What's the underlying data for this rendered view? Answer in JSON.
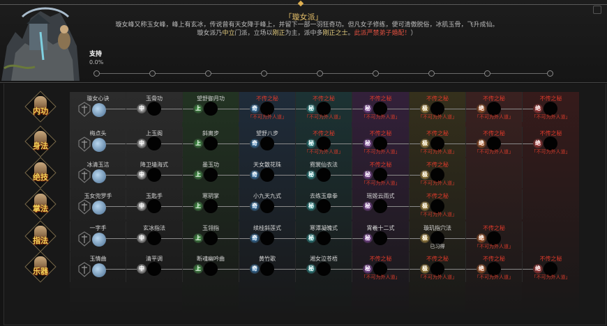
{
  "sect": {
    "title": "「璇女派」",
    "desc_line1": "璇女峰又称玉女峰，峰上有玄冰，传说曾有天女降于峰上，并留下一部一羽狂奇功。但凡女子修练，便可清傲脱俗，冰肌玉骨，飞升成仙。",
    "desc_line2_a": "璇女派乃",
    "desc_line2_b": "中立",
    "desc_line2_c": "门派，立场以",
    "desc_line2_d": "刚正",
    "desc_line2_e": "为主，派中多",
    "desc_line2_f": "刚正之士",
    "desc_line2_g": "。",
    "desc_line2_h": "此派严禁弟子婚配！",
    "desc_line2_i": "）"
  },
  "support": {
    "label": "支持",
    "percent": "0.0%",
    "value": 0
  },
  "tier_colors": [
    "#2c2c2c",
    "#2c2c2c",
    "#223322",
    "#1f2c3a",
    "#1c3334",
    "#33203a",
    "#35301c",
    "#3a2120",
    "#361b1b"
  ],
  "badges": [
    {
      "char": "中",
      "color": "#e6e6e6"
    },
    {
      "char": "中",
      "color": "#e6e6e6"
    },
    {
      "char": "上",
      "color": "#4caf50"
    },
    {
      "char": "奇",
      "color": "#3a8fd6"
    },
    {
      "char": "秘",
      "color": "#2ab0b0"
    },
    {
      "char": "秘",
      "color": "#a34fc8"
    },
    {
      "char": "极",
      "color": "#e2b64a"
    },
    {
      "char": "绝",
      "color": "#e06a2a"
    },
    {
      "char": "绝",
      "color": "#d93a3a"
    }
  ],
  "rows": [
    {
      "category": "内功",
      "cells": [
        {
          "name": "璇女心诀",
          "state": "first"
        },
        {
          "name": "玉骨功",
          "state": "open"
        },
        {
          "name": "望舒御月功",
          "state": "open"
        },
        {
          "name": "不传之秘",
          "state": "locked",
          "sub": "「不可为外人道」"
        },
        {
          "name": "不传之秘",
          "state": "locked",
          "sub": "「不可为外人道」"
        },
        {
          "name": "不传之秘",
          "state": "locked",
          "sub": "「不可为外人道」"
        },
        {
          "name": "不传之秘",
          "state": "locked",
          "sub": "「不可为外人道」"
        },
        {
          "name": "不传之秘",
          "state": "locked",
          "sub": "「不可为外人道」"
        },
        {
          "name": "不传之秘",
          "state": "locked",
          "sub": "「不可为外人道」"
        }
      ]
    },
    {
      "category": "身法",
      "cells": [
        {
          "name": "梅点头",
          "state": "first"
        },
        {
          "name": "上玉阁",
          "state": "open"
        },
        {
          "name": "斜离步",
          "state": "open"
        },
        {
          "name": "望舒八步",
          "state": "open"
        },
        {
          "name": "不传之秘",
          "state": "locked",
          "sub": "「不可为外人道」"
        },
        {
          "name": "不传之秘",
          "state": "locked",
          "sub": "「不可为外人道」"
        },
        {
          "name": "不传之秘",
          "state": "locked",
          "sub": "「不可为外人道」"
        },
        {
          "name": "不传之秘",
          "state": "locked",
          "sub": "「不可为外人道」"
        },
        {
          "name": "不传之秘",
          "state": "locked",
          "sub": "「不可为外人道」"
        }
      ]
    },
    {
      "category": "绝技",
      "cells": [
        {
          "name": "冰清玉洁",
          "state": "first"
        },
        {
          "name": "降卫墙海式",
          "state": "open"
        },
        {
          "name": "墨玉功",
          "state": "open"
        },
        {
          "name": "天女散花珠",
          "state": "open"
        },
        {
          "name": "霓裳仙衣法",
          "state": "open"
        },
        {
          "name": "不传之秘",
          "state": "locked",
          "sub": "「不可为外人道」"
        },
        {
          "name": "不传之秘",
          "state": "locked",
          "sub": "「不可为外人道」"
        },
        {
          "name": "",
          "state": "empty"
        },
        {
          "name": "",
          "state": "empty"
        }
      ]
    },
    {
      "category": "掌法",
      "cells": [
        {
          "name": "玉女兜罗手",
          "state": "first"
        },
        {
          "name": "玉匙手",
          "state": "open"
        },
        {
          "name": "寒玥掌",
          "state": "open"
        },
        {
          "name": "小九天九式",
          "state": "open"
        },
        {
          "name": "去练玉章拳",
          "state": "open"
        },
        {
          "name": "瑶姬云雨式",
          "state": "open"
        },
        {
          "name": "不传之秘",
          "state": "locked",
          "sub": "「不可为外人道」"
        },
        {
          "name": "",
          "state": "empty"
        },
        {
          "name": "",
          "state": "empty"
        }
      ]
    },
    {
      "category": "指法",
      "cells": [
        {
          "name": "一字手",
          "state": "first"
        },
        {
          "name": "玄冰指法",
          "state": "open"
        },
        {
          "name": "玉翎指",
          "state": "open"
        },
        {
          "name": "续桂斜莲式",
          "state": "open"
        },
        {
          "name": "寒潭凝魄式",
          "state": "open"
        },
        {
          "name": "霄羲十二式",
          "state": "open"
        },
        {
          "name": "璇玑指穴法",
          "state": "open",
          "learned": "已习得"
        },
        {
          "name": "不传之秘",
          "state": "locked",
          "sub": "「不可为外人道」"
        },
        {
          "name": "",
          "state": "empty"
        }
      ]
    },
    {
      "category": "乐器",
      "cells": [
        {
          "name": "玉情曲",
          "state": "first"
        },
        {
          "name": "清平调",
          "state": "open"
        },
        {
          "name": "断魂幽吟曲",
          "state": "open"
        },
        {
          "name": "黄竹歌",
          "state": "open"
        },
        {
          "name": "湘女泣苍梧",
          "state": "open"
        },
        {
          "name": "不传之秘",
          "state": "locked",
          "sub": "「不可为外人道」"
        },
        {
          "name": "不传之秘",
          "state": "locked",
          "sub": "「不可为外人道」"
        },
        {
          "name": "不传之秘",
          "state": "locked",
          "sub": "「不可为外人道」"
        },
        {
          "name": "不传之秘",
          "state": "locked",
          "sub": "「不可为外人道」"
        }
      ]
    }
  ]
}
